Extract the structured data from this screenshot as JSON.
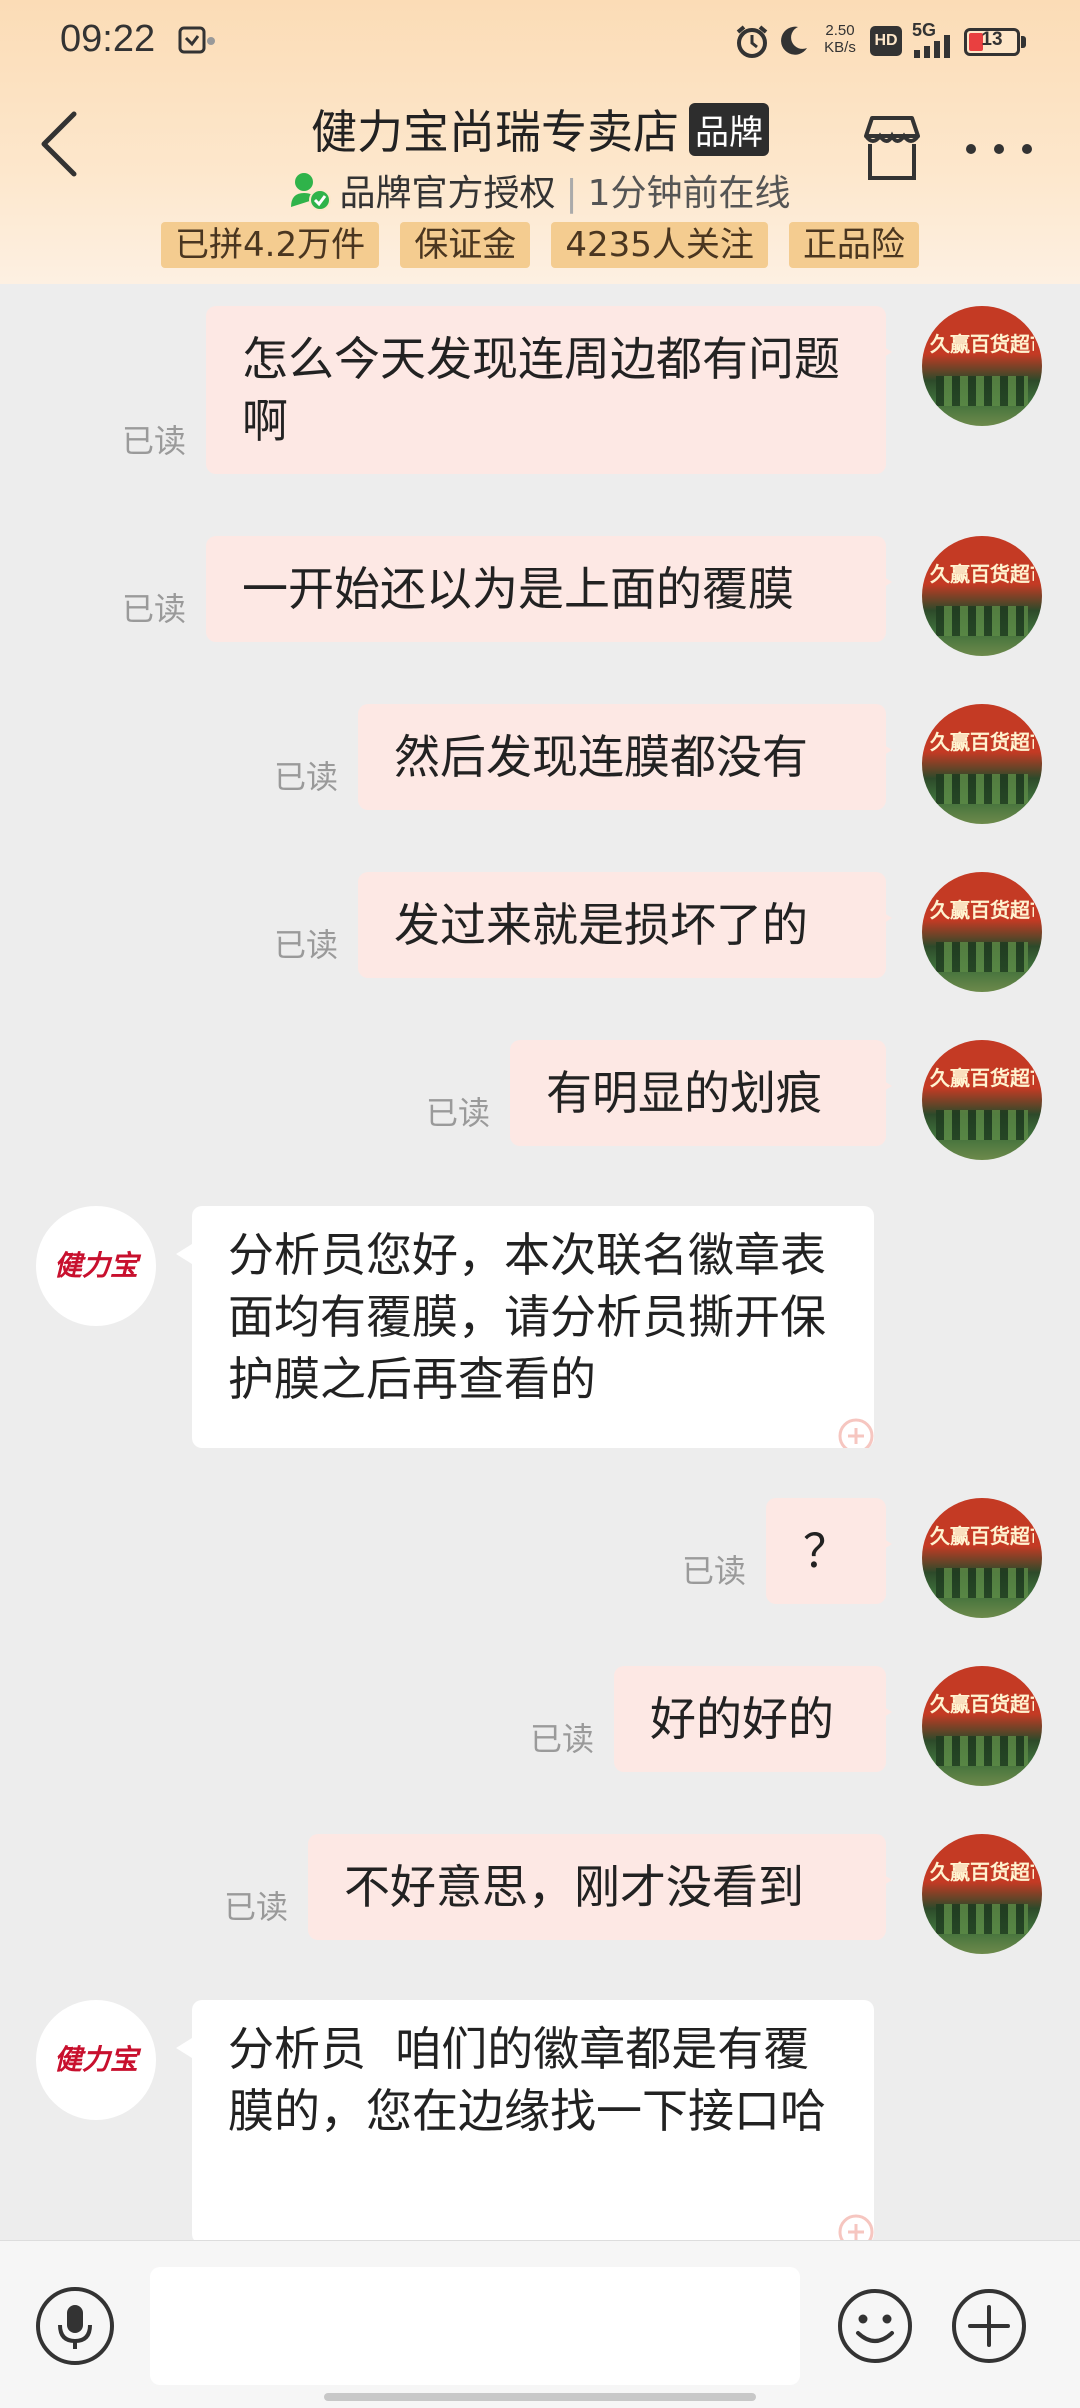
{
  "status_bar": {
    "time": "09:22",
    "net_speed_value": "2.50",
    "net_speed_unit": "KB/s",
    "hd": "HD",
    "network": "5G",
    "battery": "13"
  },
  "header": {
    "store_name": "健力宝尚瑞专卖店",
    "brand_badge": "品牌",
    "verified_text": "品牌官方授权",
    "divider": "|",
    "online_status": "1分钟前在线",
    "tags": [
      "已拼4.2万件",
      "保证金",
      "4235人关注",
      "正品险"
    ]
  },
  "avatars": {
    "store_sign": "久赢百货超市",
    "seller_logo": "健力宝"
  },
  "messages": [
    {
      "side": "out",
      "text": "怎么今天发现连周边都有问题啊",
      "read": "已读"
    },
    {
      "side": "out",
      "text": "一开始还以为是上面的覆膜",
      "read": "已读"
    },
    {
      "side": "out",
      "text": "然后发现连膜都没有",
      "read": "已读"
    },
    {
      "side": "out",
      "text": "发过来就是损坏了的",
      "read": "已读"
    },
    {
      "side": "out",
      "text": "有明显的划痕",
      "read": "已读"
    },
    {
      "side": "in",
      "text": "分析员您好，本次联名徽章表面均有覆膜，请分析员撕开保护膜之后再查看的"
    },
    {
      "side": "out",
      "text": "？",
      "read": "已读"
    },
    {
      "side": "out",
      "text": "好的好的",
      "read": "已读"
    },
    {
      "side": "out",
      "text": "不好意思，刚才没看到",
      "read": "已读"
    },
    {
      "side": "in",
      "text": "分析员  咱们的徽章都是有覆膜的，您在边缘找一下接口哈"
    }
  ],
  "input": {
    "value": "",
    "placeholder": ""
  },
  "colors": {
    "header_top": "#fbdcb6",
    "tag_bg": "#f4cc90",
    "bubble_out": "#fde8e4",
    "bubble_in": "#ffffff",
    "chat_bg": "#ededed",
    "brand_red": "#c8102e"
  },
  "icons": [
    "back-arrow-icon",
    "store-icon",
    "more-icon",
    "verified-icon",
    "microphone-icon",
    "emoji-icon",
    "plus-icon"
  ]
}
